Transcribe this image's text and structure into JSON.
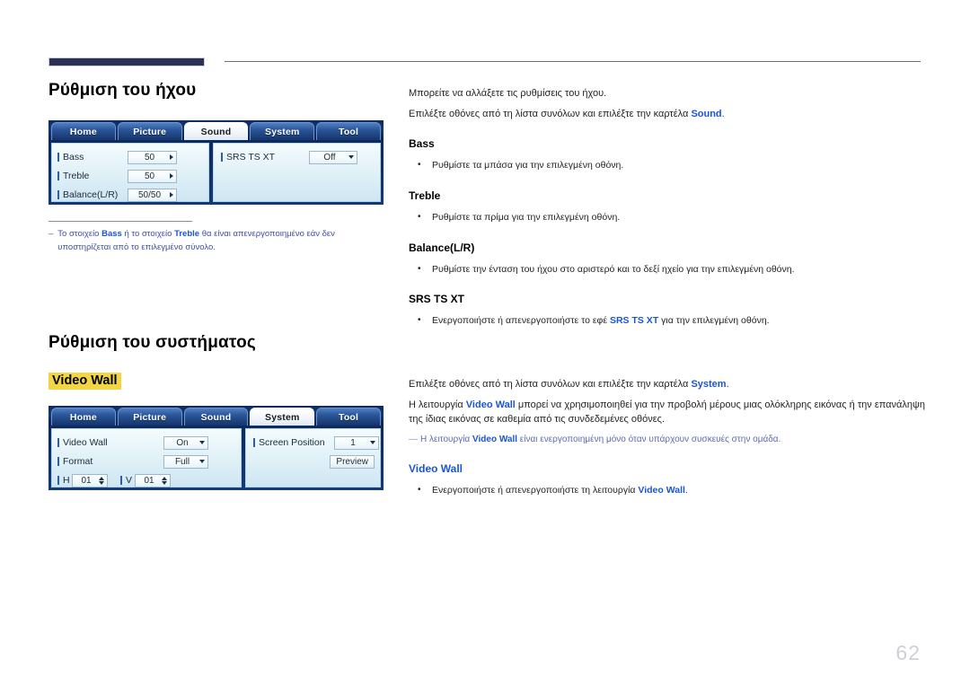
{
  "page": {
    "number": "62"
  },
  "sections": [
    {
      "title": "Ρύθμιση του ήχου",
      "panel": {
        "tabs": [
          {
            "label": "Home",
            "active": false
          },
          {
            "label": "Picture",
            "active": false
          },
          {
            "label": "Sound",
            "active": true
          },
          {
            "label": "System",
            "active": false
          },
          {
            "label": "Tool",
            "active": false
          }
        ],
        "left_rows": [
          {
            "label": "Bass",
            "value": "50",
            "control": "stepper-right"
          },
          {
            "label": "Treble",
            "value": "50",
            "control": "stepper-right"
          },
          {
            "label": "Balance(L/R)",
            "value": "50/50",
            "control": "stepper-right"
          }
        ],
        "right_rows": [
          {
            "label": "SRS TS XT",
            "value": "Off",
            "control": "dropdown"
          }
        ]
      },
      "footnote": {
        "dash": "–",
        "part1": "Το στοιχείο ",
        "term1": "Bass",
        "part2": " ή το στοιχείο ",
        "term2": "Treble",
        "part3": " θα είναι απενεργοποιημένο εάν δεν υποστηρίζεται από το επιλεγμένο σύνολο."
      }
    },
    {
      "title": "Ρύθμιση του συστήματος",
      "highlight_term": "Video Wall",
      "panel": {
        "tabs": [
          {
            "label": "Home",
            "active": false
          },
          {
            "label": "Picture",
            "active": false
          },
          {
            "label": "Sound",
            "active": false
          },
          {
            "label": "System",
            "active": true
          },
          {
            "label": "Tool",
            "active": false
          }
        ],
        "left_rows": [
          {
            "label": "Video Wall",
            "value": "On",
            "control": "dropdown"
          },
          {
            "label": "Format",
            "value": "Full",
            "control": "dropdown"
          }
        ],
        "hv_row": {
          "h_label": "H",
          "h_value": "01",
          "v_label": "V",
          "v_value": "01"
        },
        "right_rows": [
          {
            "label": "Screen Position",
            "value": "1",
            "control": "dropdown"
          }
        ],
        "preview_button": "Preview"
      }
    }
  ],
  "right_column": {
    "sound": {
      "intro1": "Μπορείτε να αλλάξετε τις ρυθμίσεις του ήχου.",
      "intro2_a": "Επιλέξτε οθόνες από τη λίστα συνόλων και επιλέξτε την καρτέλα ",
      "intro2_term": "Sound",
      "intro2_b": ".",
      "items": [
        {
          "heading": "Bass",
          "bullet": "Ρυθμίστε τα μπάσα για την επιλεγμένη οθόνη."
        },
        {
          "heading": "Treble",
          "bullet": "Ρυθμίστε τα πρίμα για την επιλεγμένη οθόνη."
        },
        {
          "heading": "Balance(L/R)",
          "bullet": "Ρυθμίστε την ένταση του ήχου στο αριστερό και το δεξί ηχείο για την επιλεγμένη οθόνη."
        }
      ],
      "srs": {
        "heading": "SRS TS XT",
        "bullet_a": "Ενεργοποιήστε ή απενεργοποιήστε το εφέ ",
        "bullet_term": "SRS TS XT",
        "bullet_b": " για την επιλεγμένη οθόνη."
      }
    },
    "system": {
      "intro1_a": "Επιλέξτε οθόνες από τη λίστα συνόλων και επιλέξτε την καρτέλα ",
      "intro1_term": "System",
      "intro1_b": ".",
      "intro2_a": "Η λειτουργία ",
      "intro2_term": "Video Wall",
      "intro2_b": " μπορεί να χρησιμοποιηθεί για την προβολή μέρους μιας ολόκληρης εικόνας ή την επανάληψη της ίδιας εικόνας σε καθεμία από τις συνδεδεμένες οθόνες.",
      "note_dash": "—",
      "note_a": "Η λειτουργία ",
      "note_term": "Video Wall",
      "note_b": " είναι ενεργοποιημένη μόνο όταν υπάρχουν συσκευές στην ομάδα.",
      "heading": "Video Wall",
      "bullet_a": "Ενεργοποιήστε ή απενεργοποιήστε τη λειτουργία ",
      "bullet_term": "Video Wall",
      "bullet_b": "."
    }
  },
  "colors": {
    "accent_blue": "#1a55d8",
    "highlight_yellow": "#f2d544",
    "rule_navy": "#2b3157",
    "osd_navy": "#0c2a5e"
  }
}
